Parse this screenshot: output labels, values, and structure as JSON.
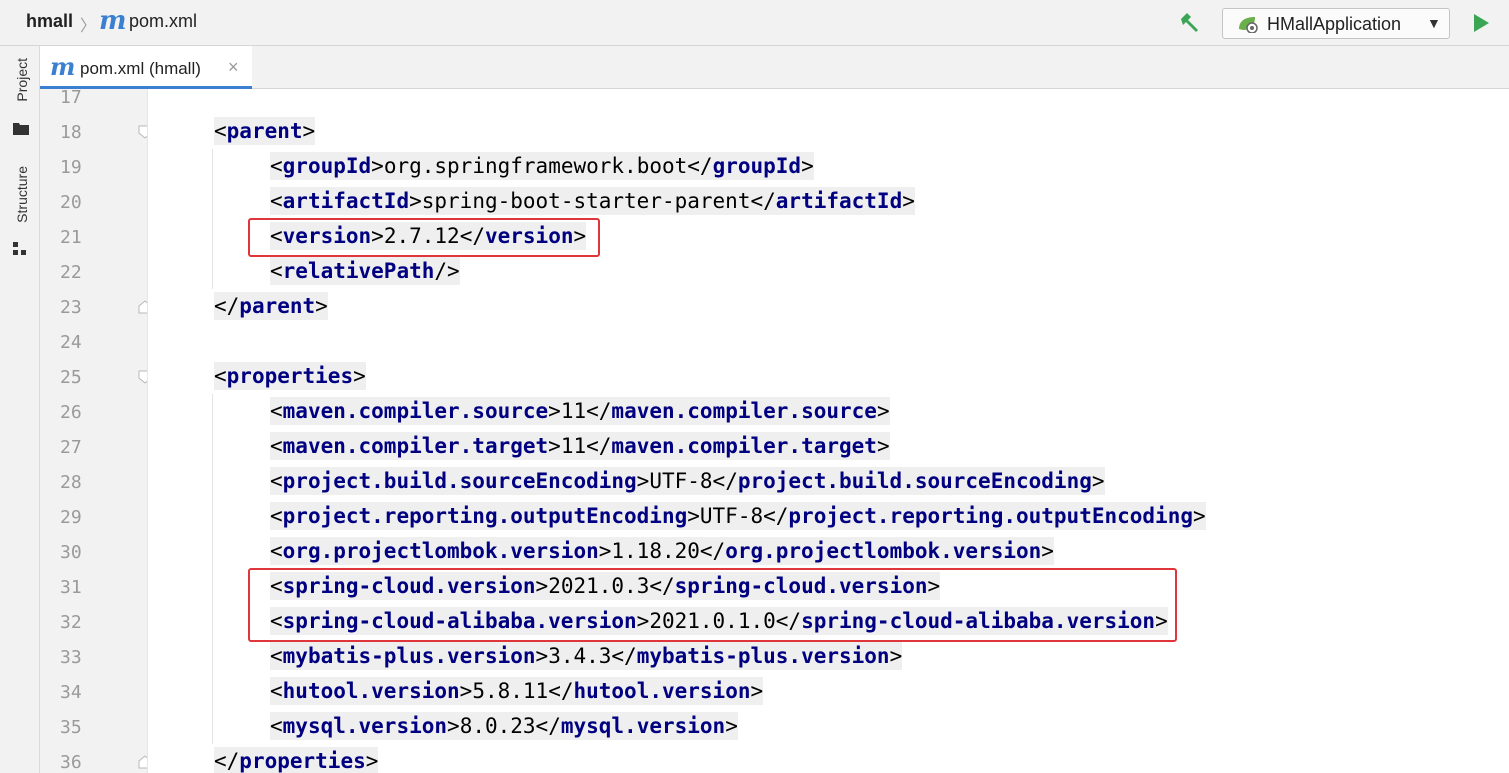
{
  "breadcrumb": {
    "project": "hmall",
    "module_icon": "m",
    "file": "pom.xml"
  },
  "toolbar": {
    "build_icon": "hammer-icon",
    "run_config_label": "HMallApplication",
    "run_icon": "play-icon"
  },
  "sidebar": {
    "project_label": "Project",
    "structure_label": "Structure"
  },
  "tab": {
    "icon": "m",
    "label": "pom.xml (hmall)",
    "close": "×"
  },
  "lines": [
    {
      "num": "17",
      "indent": 0,
      "parts": []
    },
    {
      "num": "18",
      "indent": 1,
      "parts": [
        [
          "br",
          "<"
        ],
        [
          "tg",
          "parent"
        ],
        [
          "br",
          ">"
        ]
      ]
    },
    {
      "num": "19",
      "indent": 2,
      "parts": [
        [
          "br",
          "<"
        ],
        [
          "tg",
          "groupId"
        ],
        [
          "br",
          ">"
        ],
        [
          "tx",
          "org.springframework.boot"
        ],
        [
          "br",
          "</"
        ],
        [
          "tg",
          "groupId"
        ],
        [
          "br",
          ">"
        ]
      ]
    },
    {
      "num": "20",
      "indent": 2,
      "parts": [
        [
          "br",
          "<"
        ],
        [
          "tg",
          "artifactId"
        ],
        [
          "br",
          ">"
        ],
        [
          "tx",
          "spring-boot-starter-parent"
        ],
        [
          "br",
          "</"
        ],
        [
          "tg",
          "artifactId"
        ],
        [
          "br",
          ">"
        ]
      ]
    },
    {
      "num": "21",
      "indent": 2,
      "parts": [
        [
          "br",
          "<"
        ],
        [
          "tg",
          "version"
        ],
        [
          "br",
          ">"
        ],
        [
          "tx",
          "2.7.12"
        ],
        [
          "br",
          "</"
        ],
        [
          "tg",
          "version"
        ],
        [
          "br",
          ">"
        ]
      ]
    },
    {
      "num": "22",
      "indent": 2,
      "parts": [
        [
          "br",
          "<"
        ],
        [
          "tg",
          "relativePath"
        ],
        [
          "br",
          "/>"
        ]
      ]
    },
    {
      "num": "23",
      "indent": 1,
      "parts": [
        [
          "br",
          "</"
        ],
        [
          "tg",
          "parent"
        ],
        [
          "br",
          ">"
        ]
      ]
    },
    {
      "num": "24",
      "indent": 0,
      "parts": []
    },
    {
      "num": "25",
      "indent": 1,
      "parts": [
        [
          "br",
          "<"
        ],
        [
          "tg",
          "properties"
        ],
        [
          "br",
          ">"
        ]
      ]
    },
    {
      "num": "26",
      "indent": 2,
      "parts": [
        [
          "br",
          "<"
        ],
        [
          "tg",
          "maven.compiler.source"
        ],
        [
          "br",
          ">"
        ],
        [
          "tx",
          "11"
        ],
        [
          "br",
          "</"
        ],
        [
          "tg",
          "maven.compiler.source"
        ],
        [
          "br",
          ">"
        ]
      ]
    },
    {
      "num": "27",
      "indent": 2,
      "parts": [
        [
          "br",
          "<"
        ],
        [
          "tg",
          "maven.compiler.target"
        ],
        [
          "br",
          ">"
        ],
        [
          "tx",
          "11"
        ],
        [
          "br",
          "</"
        ],
        [
          "tg",
          "maven.compiler.target"
        ],
        [
          "br",
          ">"
        ]
      ]
    },
    {
      "num": "28",
      "indent": 2,
      "parts": [
        [
          "br",
          "<"
        ],
        [
          "tg",
          "project.build.sourceEncoding"
        ],
        [
          "br",
          ">"
        ],
        [
          "tx",
          "UTF-8"
        ],
        [
          "br",
          "</"
        ],
        [
          "tg",
          "project.build.sourceEncoding"
        ],
        [
          "br",
          ">"
        ]
      ]
    },
    {
      "num": "29",
      "indent": 2,
      "parts": [
        [
          "br",
          "<"
        ],
        [
          "tg",
          "project.reporting.outputEncoding"
        ],
        [
          "br",
          ">"
        ],
        [
          "tx",
          "UTF-8"
        ],
        [
          "br",
          "</"
        ],
        [
          "tg",
          "project.reporting.outputEncoding"
        ],
        [
          "br",
          ">"
        ]
      ]
    },
    {
      "num": "30",
      "indent": 2,
      "parts": [
        [
          "br",
          "<"
        ],
        [
          "tg",
          "org.projectlombok.version"
        ],
        [
          "br",
          ">"
        ],
        [
          "tx",
          "1.18.20"
        ],
        [
          "br",
          "</"
        ],
        [
          "tg",
          "org.projectlombok.version"
        ],
        [
          "br",
          ">"
        ]
      ]
    },
    {
      "num": "31",
      "indent": 2,
      "parts": [
        [
          "br",
          "<"
        ],
        [
          "tg",
          "spring-cloud.version"
        ],
        [
          "br",
          ">"
        ],
        [
          "tx",
          "2021.0.3"
        ],
        [
          "br",
          "</"
        ],
        [
          "tg",
          "spring-cloud.version"
        ],
        [
          "br",
          ">"
        ]
      ]
    },
    {
      "num": "32",
      "indent": 2,
      "parts": [
        [
          "br",
          "<"
        ],
        [
          "tg",
          "spring-cloud-alibaba.version"
        ],
        [
          "br",
          ">"
        ],
        [
          "tx",
          "2021.0.1.0"
        ],
        [
          "br",
          "</"
        ],
        [
          "tg",
          "spring-cloud-alibaba.version"
        ],
        [
          "br",
          ">"
        ]
      ]
    },
    {
      "num": "33",
      "indent": 2,
      "parts": [
        [
          "br",
          "<"
        ],
        [
          "tg",
          "mybatis-plus.version"
        ],
        [
          "br",
          ">"
        ],
        [
          "tx",
          "3.4.3"
        ],
        [
          "br",
          "</"
        ],
        [
          "tg",
          "mybatis-plus.version"
        ],
        [
          "br",
          ">"
        ]
      ]
    },
    {
      "num": "34",
      "indent": 2,
      "parts": [
        [
          "br",
          "<"
        ],
        [
          "tg",
          "hutool.version"
        ],
        [
          "br",
          ">"
        ],
        [
          "tx",
          "5.8.11"
        ],
        [
          "br",
          "</"
        ],
        [
          "tg",
          "hutool.version"
        ],
        [
          "br",
          ">"
        ]
      ]
    },
    {
      "num": "35",
      "indent": 2,
      "parts": [
        [
          "br",
          "<"
        ],
        [
          "tg",
          "mysql.version"
        ],
        [
          "br",
          ">"
        ],
        [
          "tx",
          "8.0.23"
        ],
        [
          "br",
          "</"
        ],
        [
          "tg",
          "mysql.version"
        ],
        [
          "br",
          ">"
        ]
      ]
    },
    {
      "num": "36",
      "indent": 1,
      "parts": [
        [
          "br",
          "</"
        ],
        [
          "tg",
          "properties"
        ],
        [
          "br",
          ">"
        ]
      ]
    }
  ],
  "fold_markers": {
    "18": "open",
    "23": "close",
    "25": "open",
    "36": "close"
  },
  "highlights": [
    {
      "from_line": "21",
      "to_line": "21",
      "color": "#e0353b"
    },
    {
      "from_line": "31",
      "to_line": "32",
      "color": "#e0353b"
    }
  ],
  "colors": {
    "tag": "#000080",
    "accent": "#3b7fd1",
    "highlight": "#e0353b",
    "run": "#3aa655"
  }
}
